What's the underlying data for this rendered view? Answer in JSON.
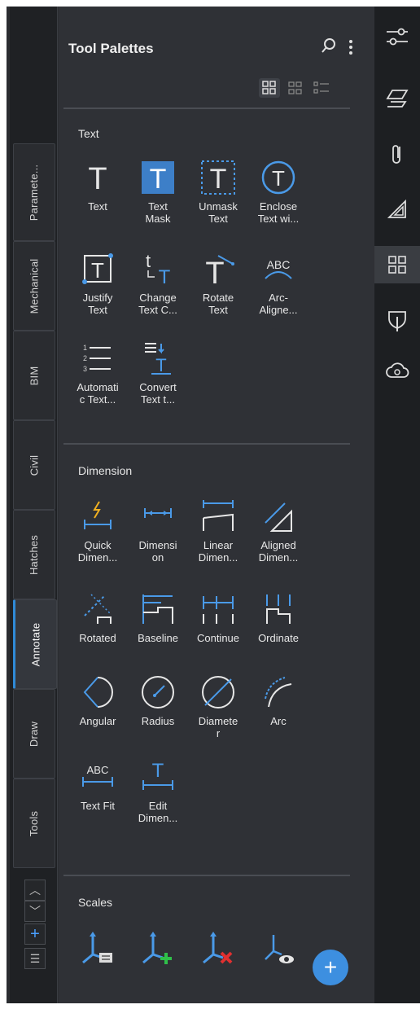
{
  "panel": {
    "title": "Tool Palettes"
  },
  "vertical_tabs": [
    {
      "label": "Paramete..."
    },
    {
      "label": "Mechanical"
    },
    {
      "label": "BIM"
    },
    {
      "label": "Civil"
    },
    {
      "label": "Hatches"
    },
    {
      "label": "Annotate",
      "active": true
    },
    {
      "label": "Draw"
    },
    {
      "label": "Tools"
    }
  ],
  "sections": {
    "text": {
      "label": "Text",
      "tools": [
        {
          "label": "Text"
        },
        {
          "label": "Text\nMask"
        },
        {
          "label": "Unmask\nText"
        },
        {
          "label": "Enclose\nText wi..."
        },
        {
          "label": "Justify\nText"
        },
        {
          "label": "Change\nText C..."
        },
        {
          "label": "Rotate\nText"
        },
        {
          "label": "Arc-\nAligne..."
        },
        {
          "label": "Automati\nc Text..."
        },
        {
          "label": "Convert\nText t..."
        }
      ]
    },
    "dimension": {
      "label": "Dimension",
      "tools": [
        {
          "label": "Quick\nDimen..."
        },
        {
          "label": "Dimensi\non"
        },
        {
          "label": "Linear\nDimen..."
        },
        {
          "label": "Aligned\nDimen..."
        },
        {
          "label": "Rotated"
        },
        {
          "label": "Baseline"
        },
        {
          "label": "Continue"
        },
        {
          "label": "Ordinate"
        },
        {
          "label": "Angular"
        },
        {
          "label": "Radius"
        },
        {
          "label": "Diamete\nr"
        },
        {
          "label": "Arc"
        },
        {
          "label": "Text Fit"
        },
        {
          "label": "Edit\nDimen..."
        }
      ]
    },
    "scales": {
      "label": "Scales"
    }
  },
  "text_icons": {
    "ABC": "ABC",
    "T": "T",
    "arc_abc": "ABC"
  },
  "fab_label": "+",
  "colors": {
    "accent": "#3d8fe0",
    "icon_blue": "#4a9ae8"
  }
}
